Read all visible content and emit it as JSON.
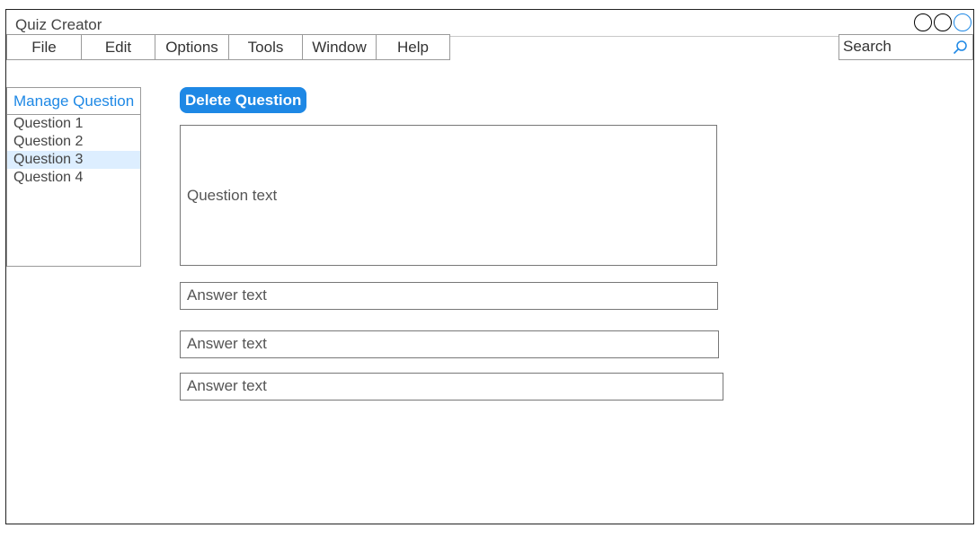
{
  "window": {
    "title": "Quiz Creator"
  },
  "menu": {
    "items": [
      {
        "label": "File"
      },
      {
        "label": "Edit"
      },
      {
        "label": "Options"
      },
      {
        "label": "Tools"
      },
      {
        "label": "Window"
      },
      {
        "label": "Help"
      }
    ]
  },
  "search": {
    "placeholder": "Search",
    "icon": "search-icon"
  },
  "sidebar": {
    "header": "Manage Question",
    "items": [
      {
        "label": "Question 1"
      },
      {
        "label": "Question 2"
      },
      {
        "label": "Question 3",
        "selected": true
      },
      {
        "label": "Question 4"
      }
    ]
  },
  "editor": {
    "delete_label": "Delete Question",
    "question_placeholder": "Question text",
    "answers": [
      {
        "placeholder": "Answer text"
      },
      {
        "placeholder": "Answer text"
      },
      {
        "placeholder": "Answer text"
      }
    ]
  },
  "colors": {
    "accent": "#1e88e5",
    "selection": "#ddeeff",
    "border": "#9a9a9a"
  }
}
